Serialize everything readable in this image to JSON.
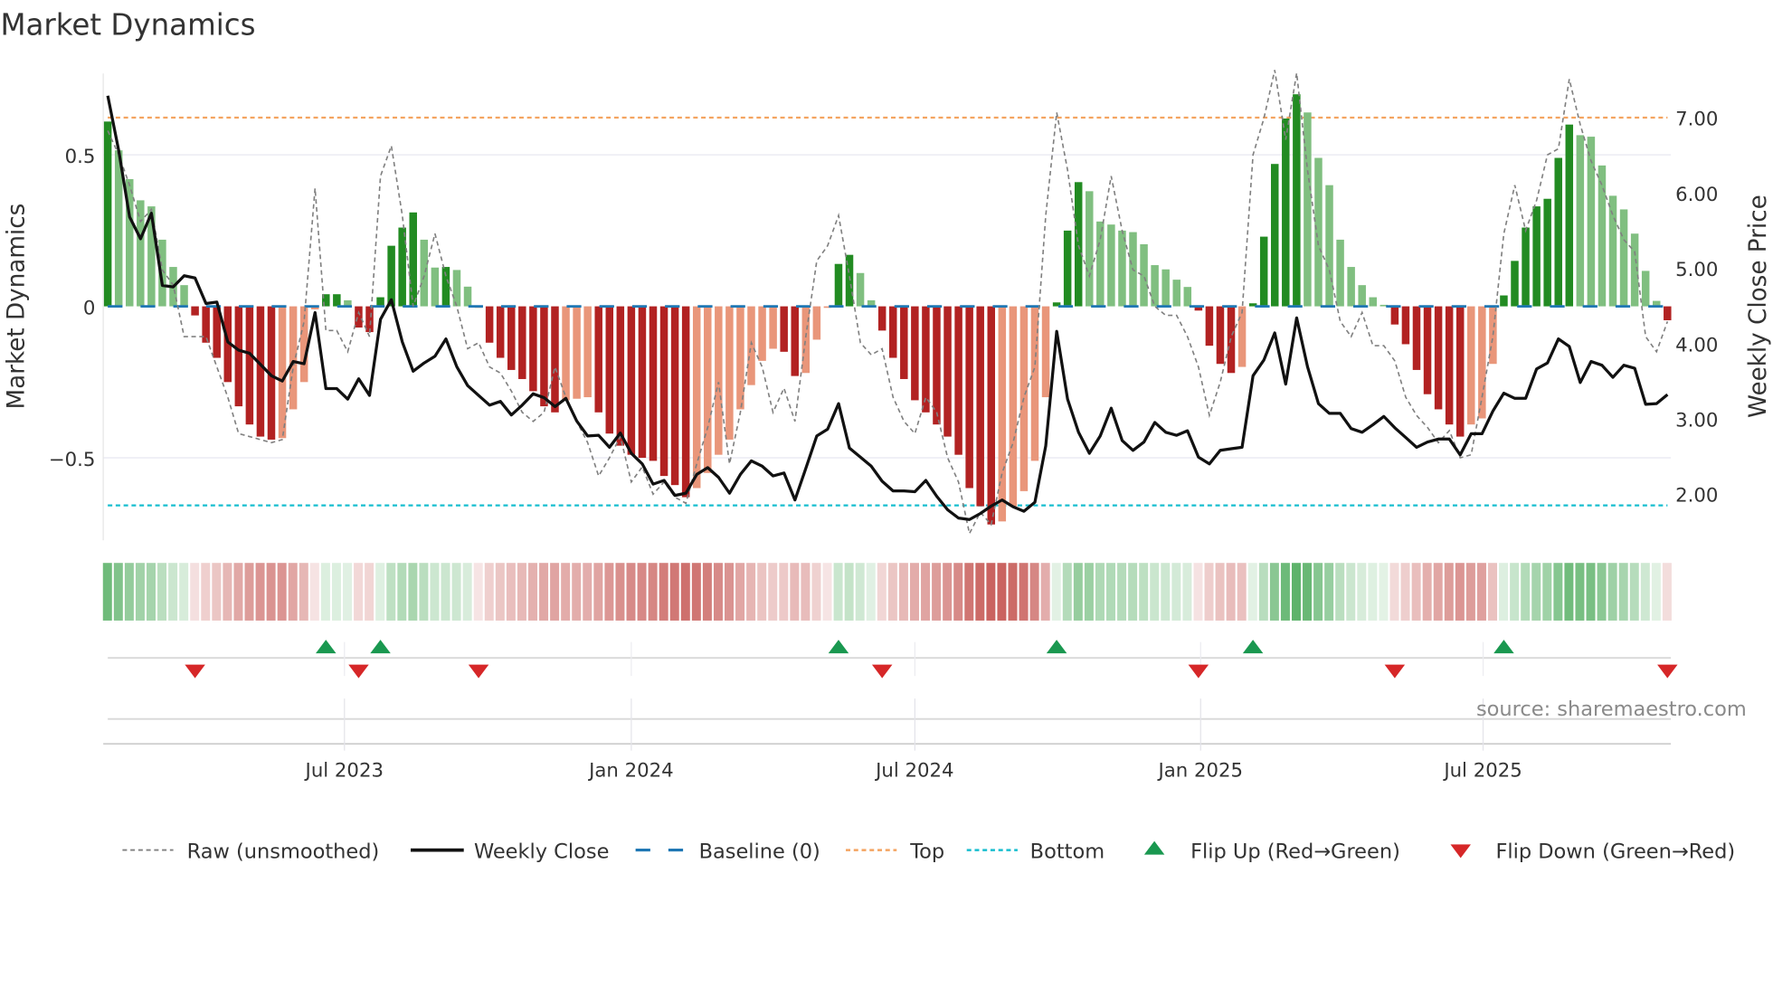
{
  "chart_data": {
    "type": "bar",
    "title": "Market Dynamics",
    "ylabel": "Market Dynamics",
    "y2label": "Weekly Close Price",
    "ylim": [
      -0.78,
      0.78
    ],
    "y2lim": [
      1.35,
      7.6
    ],
    "yticks": [
      {
        "value": 0.5,
        "label": "0.5"
      },
      {
        "value": 0,
        "label": "0"
      },
      {
        "value": -0.5,
        "label": "−0.5"
      }
    ],
    "y2ticks": [
      {
        "value": 7,
        "label": "7.00"
      },
      {
        "value": 6,
        "label": "6.00"
      },
      {
        "value": 5,
        "label": "5.00"
      },
      {
        "value": 4,
        "label": "4.00"
      },
      {
        "value": 3,
        "label": "3.00"
      },
      {
        "value": 2,
        "label": "2.00"
      }
    ],
    "xticks": [
      {
        "week": 21.7,
        "label": "Jul 2023"
      },
      {
        "week": 48.0,
        "label": "Jan 2024"
      },
      {
        "week": 74.0,
        "label": "Jul 2024"
      },
      {
        "week": 100.2,
        "label": "Jan 2025"
      },
      {
        "week": 126.1,
        "label": "Jul 2025"
      }
    ],
    "levels": {
      "top": 0.623,
      "bottom": -0.657,
      "baseline": 0
    },
    "colors": {
      "up_strong": "#228b22",
      "up_weak": "#80bf80",
      "down_strong": "#b22222",
      "down_weak": "#e9967a",
      "raw": "#808080",
      "close": "#111111",
      "baseline": "#1f77b4",
      "top": "#f4a460",
      "bottom": "#17becf",
      "flip_up": "#1a9850",
      "flip_down": "#d62728"
    },
    "series": [
      {
        "name": "Market Dynamics",
        "values": [
          0.61,
          0.515,
          0.42,
          0.35,
          0.33,
          0.22,
          0.13,
          0.07,
          -0.03,
          -0.12,
          -0.17,
          -0.25,
          -0.33,
          -0.39,
          -0.43,
          -0.44,
          -0.435,
          -0.34,
          -0.25,
          -0.01,
          0.04,
          0.04,
          0.02,
          -0.07,
          -0.085,
          0.03,
          0.2,
          0.26,
          0.31,
          0.22,
          0.128,
          0.13,
          0.12,
          0.065,
          -0.005,
          -0.12,
          -0.17,
          -0.21,
          -0.24,
          -0.28,
          -0.33,
          -0.35,
          -0.31,
          -0.305,
          -0.3,
          -0.35,
          -0.42,
          -0.46,
          -0.49,
          -0.5,
          -0.51,
          -0.56,
          -0.59,
          -0.63,
          -0.6,
          -0.55,
          -0.49,
          -0.44,
          -0.34,
          -0.26,
          -0.18,
          -0.14,
          -0.15,
          -0.23,
          -0.22,
          -0.11,
          -0.005,
          0.14,
          0.17,
          0.11,
          0.02,
          -0.08,
          -0.17,
          -0.24,
          -0.31,
          -0.35,
          -0.39,
          -0.43,
          -0.49,
          -0.6,
          -0.66,
          -0.72,
          -0.71,
          -0.66,
          -0.61,
          -0.51,
          -0.3,
          0.013,
          0.25,
          0.41,
          0.38,
          0.28,
          0.27,
          0.25,
          0.245,
          0.205,
          0.136,
          0.122,
          0.088,
          0.064,
          -0.014,
          -0.13,
          -0.19,
          -0.22,
          -0.2,
          0.01,
          0.23,
          0.47,
          0.62,
          0.7,
          0.64,
          0.49,
          0.4,
          0.22,
          0.13,
          0.07,
          0.03,
          0.005,
          -0.06,
          -0.125,
          -0.21,
          -0.29,
          -0.34,
          -0.39,
          -0.43,
          -0.39,
          -0.37,
          -0.19,
          0.036,
          0.15,
          0.26,
          0.33,
          0.355,
          0.49,
          0.6,
          0.565,
          0.56,
          0.465,
          0.365,
          0.32,
          0.24,
          0.117,
          0.018,
          -0.046
        ]
      },
      {
        "name": "Raw (unsmoothed)",
        "values": [
          0.58,
          0.5,
          0.4,
          0.28,
          0.32,
          0.12,
          0.07,
          -0.1,
          -0.1,
          -0.1,
          -0.2,
          -0.3,
          -0.42,
          -0.43,
          -0.44,
          -0.45,
          -0.44,
          -0.2,
          -0.05,
          0.39,
          -0.08,
          -0.08,
          -0.15,
          -0.02,
          -0.1,
          0.43,
          0.53,
          0.3,
          0.0,
          0.1,
          0.24,
          0.1,
          0.0,
          -0.14,
          -0.12,
          -0.2,
          -0.22,
          -0.28,
          -0.35,
          -0.38,
          -0.35,
          -0.2,
          -0.3,
          -0.38,
          -0.45,
          -0.56,
          -0.5,
          -0.43,
          -0.58,
          -0.53,
          -0.62,
          -0.58,
          -0.63,
          -0.65,
          -0.52,
          -0.4,
          -0.25,
          -0.52,
          -0.35,
          -0.12,
          -0.2,
          -0.35,
          -0.27,
          -0.38,
          -0.1,
          0.15,
          0.2,
          0.3,
          0.1,
          -0.12,
          -0.16,
          -0.14,
          -0.3,
          -0.38,
          -0.42,
          -0.3,
          -0.35,
          -0.5,
          -0.58,
          -0.75,
          -0.68,
          -0.72,
          -0.55,
          -0.45,
          -0.3,
          -0.2,
          0.3,
          0.64,
          0.45,
          0.2,
          0.1,
          0.22,
          0.43,
          0.25,
          0.12,
          0.1,
          0.0,
          -0.03,
          -0.03,
          -0.1,
          -0.2,
          -0.36,
          -0.25,
          -0.1,
          -0.02,
          0.5,
          0.62,
          0.78,
          0.55,
          0.77,
          0.45,
          0.2,
          0.12,
          -0.05,
          -0.1,
          -0.02,
          -0.13,
          -0.13,
          -0.18,
          -0.3,
          -0.36,
          -0.4,
          -0.45,
          -0.41,
          -0.5,
          -0.49,
          -0.3,
          -0.1,
          0.24,
          0.4,
          0.25,
          0.35,
          0.5,
          0.52,
          0.75,
          0.6,
          0.48,
          0.4,
          0.3,
          0.22,
          0.18,
          -0.1,
          -0.15,
          -0.05
        ]
      },
      {
        "name": "Weekly Close",
        "axis": "right",
        "values": [
          7.29,
          6.56,
          5.68,
          5.39,
          5.73,
          4.77,
          4.75,
          4.9,
          4.87,
          4.53,
          4.55,
          4.02,
          3.91,
          3.87,
          3.72,
          3.57,
          3.5,
          3.76,
          3.73,
          4.41,
          3.4,
          3.4,
          3.26,
          3.53,
          3.31,
          4.32,
          4.58,
          4.02,
          3.63,
          3.74,
          3.83,
          4.06,
          3.69,
          3.44,
          3.31,
          3.18,
          3.23,
          3.05,
          3.18,
          3.33,
          3.28,
          3.16,
          3.27,
          2.97,
          2.77,
          2.78,
          2.62,
          2.81,
          2.54,
          2.4,
          2.13,
          2.18,
          1.98,
          2.01,
          2.26,
          2.35,
          2.22,
          2.01,
          2.26,
          2.44,
          2.37,
          2.24,
          2.28,
          1.92,
          2.34,
          2.77,
          2.86,
          3.2,
          2.61,
          2.49,
          2.37,
          2.17,
          2.04,
          2.04,
          2.03,
          2.18,
          1.97,
          1.79,
          1.68,
          1.66,
          1.74,
          1.84,
          1.92,
          1.83,
          1.77,
          1.89,
          2.64,
          4.16,
          3.26,
          2.82,
          2.54,
          2.77,
          3.14,
          2.71,
          2.58,
          2.69,
          2.95,
          2.82,
          2.78,
          2.84,
          2.49,
          2.4,
          2.58,
          2.6,
          2.62,
          3.57,
          3.78,
          4.14,
          3.46,
          4.34,
          3.69,
          3.2,
          3.07,
          3.07,
          2.87,
          2.82,
          2.92,
          3.03,
          2.88,
          2.75,
          2.62,
          2.69,
          2.73,
          2.73,
          2.52,
          2.8,
          2.8,
          3.1,
          3.34,
          3.27,
          3.27,
          3.66,
          3.74,
          4.06,
          3.96,
          3.48,
          3.76,
          3.71,
          3.55,
          3.71,
          3.67,
          3.19,
          3.2,
          3.32
        ]
      }
    ],
    "legend": {
      "position": "bottom",
      "items": [
        {
          "key": "raw",
          "label": "Raw (unsmoothed)"
        },
        {
          "key": "close",
          "label": "Weekly Close"
        },
        {
          "key": "baseline",
          "label": "Baseline (0)"
        },
        {
          "key": "top",
          "label": "Top"
        },
        {
          "key": "bottom",
          "label": "Bottom"
        },
        {
          "key": "flip_up",
          "label": "Flip Up (Red→Green)"
        },
        {
          "key": "flip_down",
          "label": "Flip Down (Green→Red)"
        }
      ]
    },
    "source": "source: sharemaestro.com"
  }
}
